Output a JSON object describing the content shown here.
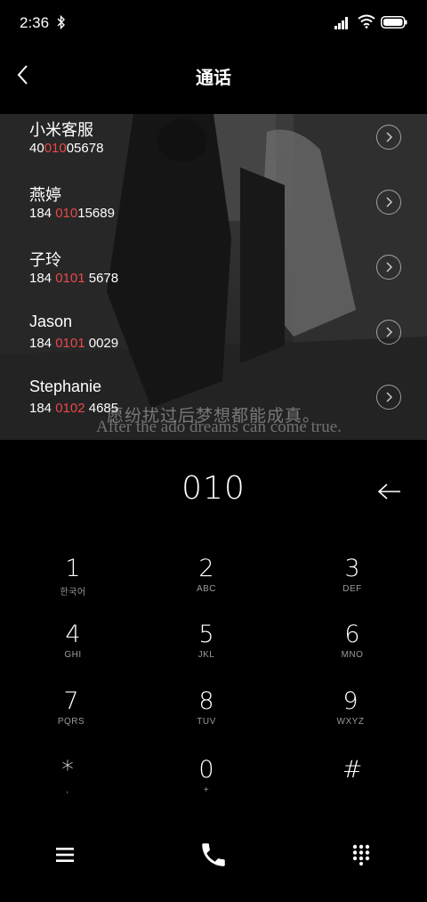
{
  "status": {
    "time": "2:36"
  },
  "header": {
    "title": "通话"
  },
  "results": [
    {
      "name": "小米客服",
      "num_pre": "40",
      "num_hl": "010",
      "num_post": "05678"
    },
    {
      "name": "燕婷",
      "num_pre": "184 ",
      "num_hl": "010",
      "num_post": "15689"
    },
    {
      "name": "子玲",
      "num_pre": "184 ",
      "num_hl": "0101",
      "num_post": " 5678"
    },
    {
      "name": "Jason",
      "num_pre": "184 ",
      "num_hl": "0101",
      "num_post": " 0029"
    },
    {
      "name": "Stephanie",
      "num_pre": "184 ",
      "num_hl": "0102",
      "num_post": " 4685"
    }
  ],
  "background_text": {
    "cn": "愿纷扰过后梦想都能成真。",
    "en": "After the ado dreams can come true."
  },
  "dialer": {
    "dialed": "010",
    "keys": [
      {
        "digit": "1",
        "letters": "한국어"
      },
      {
        "digit": "2",
        "letters": "ABC"
      },
      {
        "digit": "3",
        "letters": "DEF"
      },
      {
        "digit": "4",
        "letters": "GHI"
      },
      {
        "digit": "5",
        "letters": "JKL"
      },
      {
        "digit": "6",
        "letters": "MNO"
      },
      {
        "digit": "7",
        "letters": "PQRS"
      },
      {
        "digit": "8",
        "letters": "TUV"
      },
      {
        "digit": "9",
        "letters": "WXYZ"
      },
      {
        "digit": "*",
        "letters": ","
      },
      {
        "digit": "0",
        "letters": "+"
      },
      {
        "digit": "#",
        "letters": ""
      }
    ]
  },
  "icons": {
    "back": "chevron-left-icon",
    "backspace": "backspace-arrow-icon",
    "menu": "hamburger-menu-icon",
    "call": "phone-icon",
    "keypad": "dialpad-icon"
  },
  "colors": {
    "highlight": "#e8484a",
    "background": "#000000"
  }
}
